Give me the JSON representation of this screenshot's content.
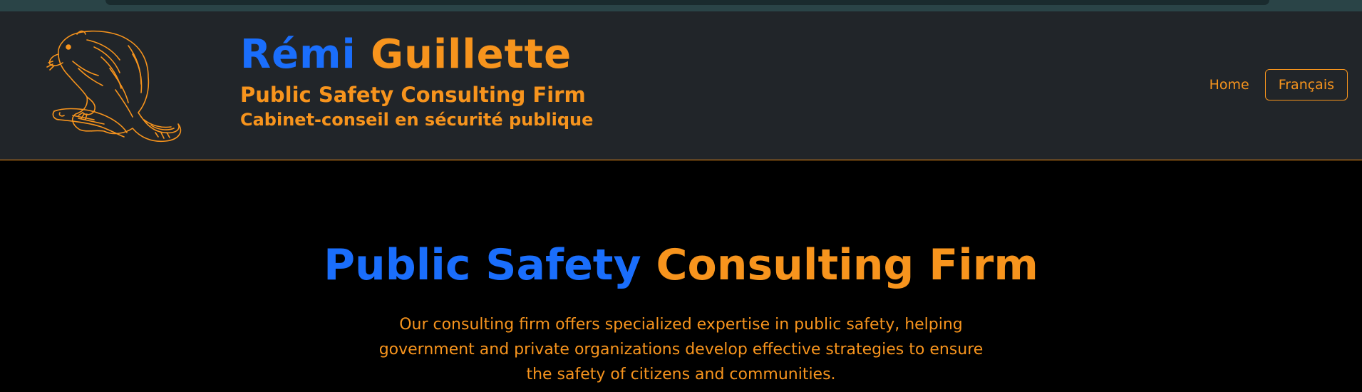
{
  "brand": {
    "first_name": "Rémi",
    "last_name": "Guillette",
    "subtitle_en": "Public Safety Consulting Firm",
    "subtitle_fr": "Cabinet-conseil en sécurité publique",
    "logo_icon": "beaver-icon"
  },
  "nav": {
    "home_label": "Home",
    "language_label": "Français"
  },
  "hero": {
    "title_part1": "Public Safety",
    "title_part2": "Consulting Firm",
    "description": "Our consulting firm offers specialized expertise in public safety, helping government and private organizations develop effective strategies to ensure the safety of citizens and communities."
  },
  "colors": {
    "accent_orange": "#f7941d",
    "accent_blue": "#1a6efc",
    "header_bg": "#212529",
    "page_bg": "#000000"
  }
}
